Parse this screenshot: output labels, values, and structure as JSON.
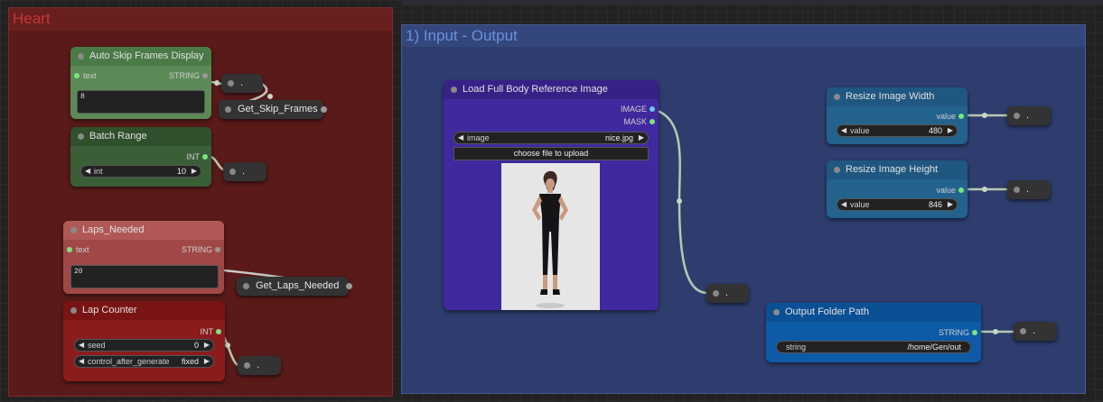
{
  "groups": {
    "heart": {
      "title": "Heart"
    },
    "io": {
      "title": "1) Input - Output"
    }
  },
  "nodes": {
    "auto_skip": {
      "title": "Auto Skip Frames Display",
      "input_label": "text",
      "output_label": "STRING",
      "text_value": "8"
    },
    "get_skip": {
      "title": "Get_Skip_Frames"
    },
    "batch_range": {
      "title": "Batch Range",
      "output_label": "INT",
      "widget_label": "int",
      "widget_value": "10"
    },
    "laps_needed": {
      "title": "Laps_Needed",
      "input_label": "text",
      "output_label": "STRING",
      "text_value": "20"
    },
    "get_laps": {
      "title": "Get_Laps_Needed"
    },
    "lap_counter": {
      "title": "Lap Counter",
      "output_label": "INT",
      "seed_label": "seed",
      "seed_value": "0",
      "control_label": "control_after_generate",
      "control_value": "fixed"
    },
    "load_image": {
      "title": "Load Full Body Reference Image",
      "out_image": "IMAGE",
      "out_mask": "MASK",
      "widget_label": "image",
      "widget_value": "nice.jpg",
      "upload_label": "choose file to upload"
    },
    "resize_w": {
      "title": "Resize Image Width",
      "output_label": "value",
      "widget_label": "value",
      "widget_value": "480"
    },
    "resize_h": {
      "title": "Resize Image Height",
      "output_label": "value",
      "widget_label": "value",
      "widget_value": "846"
    },
    "output_folder": {
      "title": "Output Folder Path",
      "output_label": "STRING",
      "widget_label": "string",
      "widget_value": "/home/Gen/out"
    }
  },
  "reroute_label": ".",
  "colors": {
    "heart_group": "#5a1a1a",
    "io_group": "#2e3d6e",
    "accent_green": "#7de37d",
    "accent_cyan": "#6ec6f0"
  }
}
